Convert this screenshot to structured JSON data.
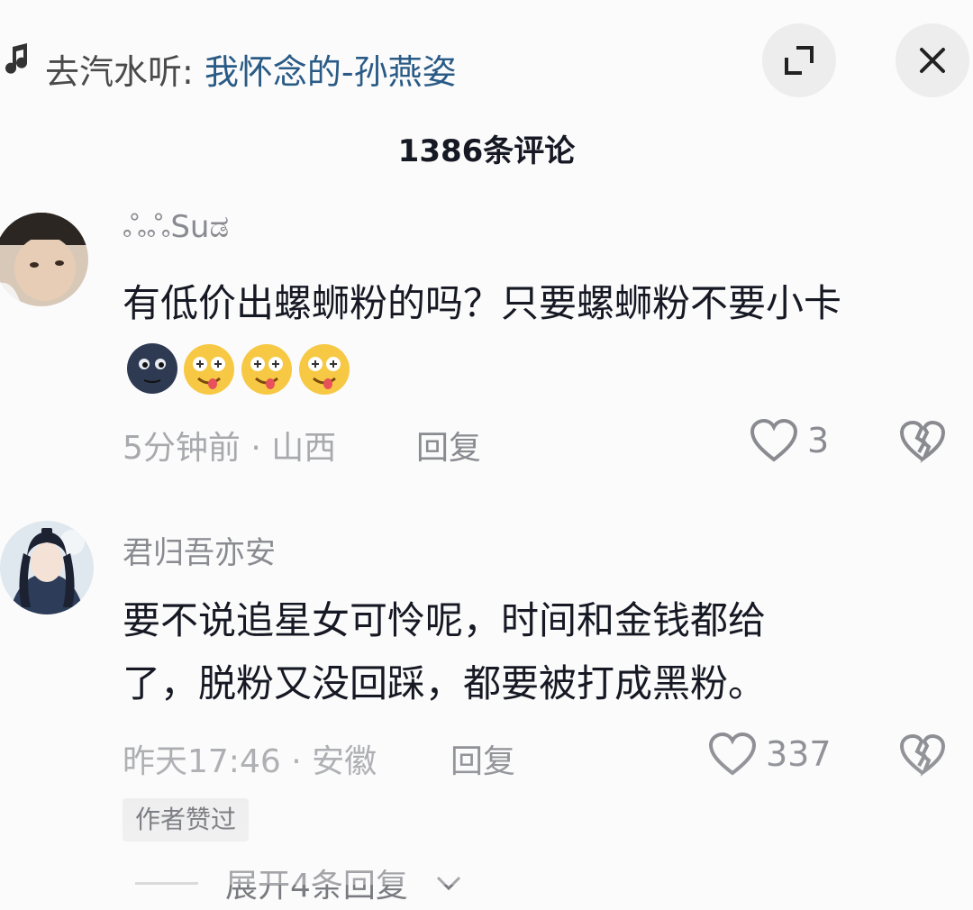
{
  "header": {
    "music_prefix": "去汽水听: ",
    "song": "我怀念的-孙燕姿",
    "icons": {
      "music": "music-note-icon",
      "expand": "expand-icon",
      "close": "close-icon"
    }
  },
  "comment_count": "1386条评论",
  "comments": [
    {
      "username": "ஃஃSuಡ",
      "text": "有低价出螺蛳粉的吗？只要螺蛳粉不要小卡",
      "emojis": [
        "dark-moon-face-emoji",
        "drooling-face-emoji",
        "drooling-face-emoji",
        "drooling-face-emoji"
      ],
      "time_location": "5分钟前 · 山西",
      "reply_label": "回复",
      "likes": "3"
    },
    {
      "username": "君归吾亦安",
      "text_line1": "要不说追星女可怜呢，时间和金钱都给",
      "text_line2": "了，脱粉又没回踩，都要被打成黑粉。",
      "time_location": "昨天17:46 · 安徽",
      "reply_label": "回复",
      "likes": "337",
      "badge": "作者赞过",
      "expand_replies": "展开4条回复"
    }
  ],
  "colors": {
    "song_link": "#2a5b86",
    "muted": "#8a8b91",
    "text": "#161823"
  }
}
